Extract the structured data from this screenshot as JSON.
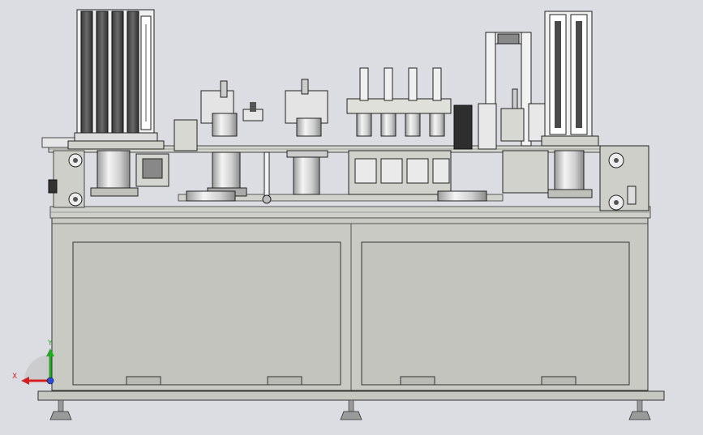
{
  "viewport": {
    "background": "#dcdde3"
  },
  "axis_triad": {
    "x_label": "X",
    "y_label": "Y",
    "x_color": "#d62020",
    "y_color": "#22aa22",
    "z_color": "#2a4bd6"
  },
  "model": {
    "body_color": "#c9cac4",
    "panel_color": "#c3c4be",
    "line_color": "#222222",
    "column_color": "#4a4a4a",
    "steel_color": "#e8e8e8"
  }
}
